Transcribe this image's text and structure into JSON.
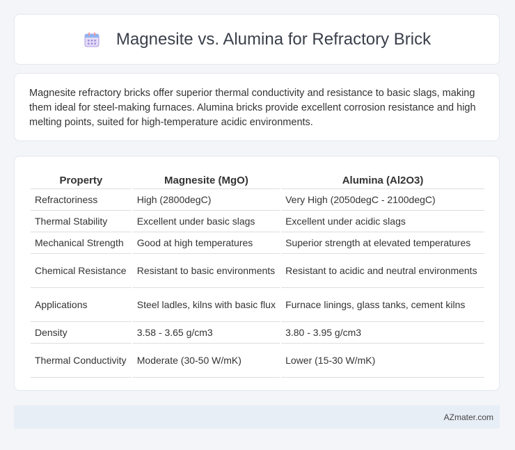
{
  "header": {
    "title": "Magnesite vs. Alumina for Refractory Brick",
    "icon": "calendar-icon"
  },
  "intro": {
    "text": "Magnesite refractory bricks offer superior thermal conductivity and resistance to basic slags, making them ideal for steel-making furnaces. Alumina bricks provide excellent corrosion resistance and high melting points, suited for high-temperature acidic environments."
  },
  "table": {
    "headers": [
      "Property",
      "Magnesite (MgO)",
      "Alumina (Al2O3)"
    ],
    "rows": [
      [
        "Refractoriness",
        "High (2800degC)",
        "Very High (2050degC - 2100degC)"
      ],
      [
        "Thermal Stability",
        "Excellent under basic slags",
        "Excellent under acidic slags"
      ],
      [
        "Mechanical Strength",
        "Good at high temperatures",
        "Superior strength at elevated temperatures"
      ],
      [
        "Chemical Resistance",
        "Resistant to basic environments",
        "Resistant to acidic and neutral environments"
      ],
      [
        "Applications",
        "Steel ladles, kilns with basic flux",
        "Furnace linings, glass tanks, cement kilns"
      ],
      [
        "Density",
        "3.58 - 3.65 g/cm3",
        "3.80 - 3.95 g/cm3"
      ],
      [
        "Thermal Conductivity",
        "Moderate (30-50 W/mK)",
        "Lower (15-30 W/mK)"
      ]
    ]
  },
  "footer": {
    "site": "AZmater.com"
  }
}
